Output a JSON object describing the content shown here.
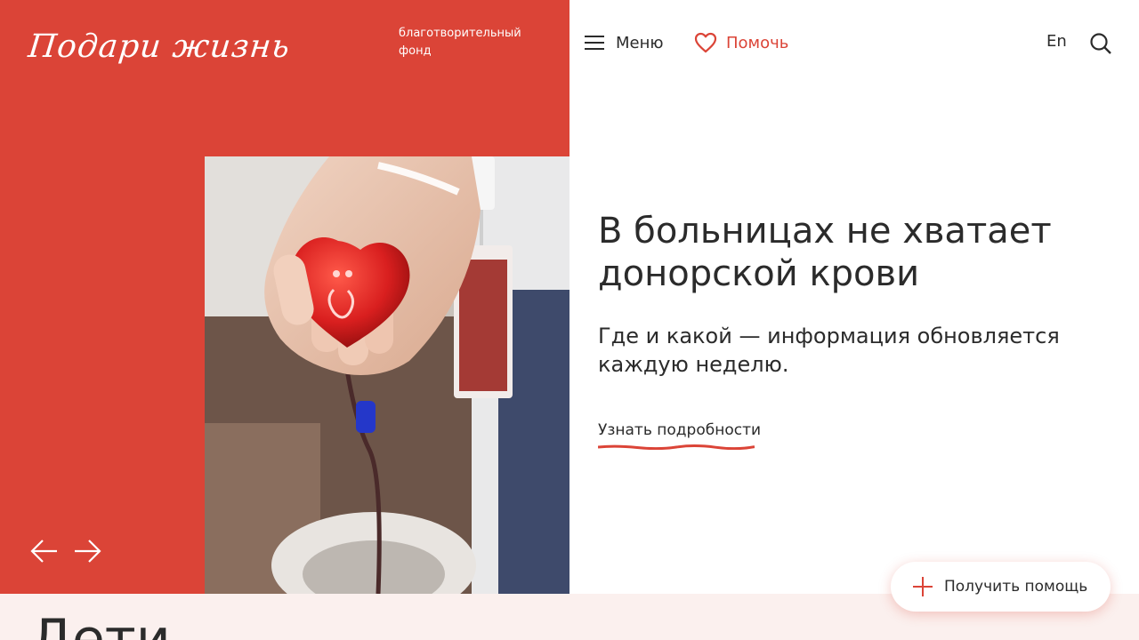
{
  "brand": {
    "logo_text": "Подари жизнь",
    "fund_label": "благотворительный фонд"
  },
  "header": {
    "menu_label": "Меню",
    "help_label": "Помочь",
    "lang_label": "En",
    "menu_icon": "hamburger-icon",
    "help_icon": "heart-icon",
    "search_icon": "search-icon"
  },
  "slide": {
    "headline": "В больницах не хватает донорской крови",
    "subtitle": "Где и какой — информация обновляется каждую неделю.",
    "link_label": "Узнать подробности",
    "image_icon": "heart-stress-ball-photo",
    "prev_icon": "arrow-left-icon",
    "next_icon": "arrow-right-icon"
  },
  "floating": {
    "get_help_label": "Получить помощь",
    "get_help_icon": "plus-icon"
  },
  "next_section": {
    "title": "Дети"
  },
  "colors": {
    "brand_red": "#db4437",
    "text_dark": "#2b2b2b",
    "band_pink": "#fbf0ee"
  }
}
